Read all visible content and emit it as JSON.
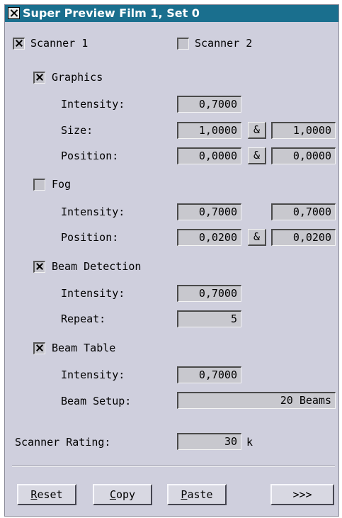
{
  "window": {
    "title": "Super Preview Film 1, Set 0"
  },
  "scanners": [
    {
      "label": "Scanner 1",
      "checked": true
    },
    {
      "label": "Scanner 2",
      "checked": false
    }
  ],
  "graphics": {
    "label": "Graphics",
    "checked": true,
    "intensity_label": "Intensity:",
    "intensity": "0,7000",
    "size_label": "Size:",
    "size_x": "1,0000",
    "size_y": "1,0000",
    "position_label": "Position:",
    "position_x": "0,0000",
    "position_y": "0,0000",
    "link": "&"
  },
  "fog": {
    "label": "Fog",
    "checked": false,
    "intensity_label": "Intensity:",
    "intensity_a": "0,7000",
    "intensity_b": "0,7000",
    "position_label": "Position:",
    "position_x": "0,0200",
    "position_y": "0,0200",
    "link": "&"
  },
  "beam_detection": {
    "label": "Beam Detection",
    "checked": true,
    "intensity_label": "Intensity:",
    "intensity": "0,7000",
    "repeat_label": "Repeat:",
    "repeat": "5"
  },
  "beam_table": {
    "label": "Beam Table",
    "checked": true,
    "intensity_label": "Intensity:",
    "intensity": "0,7000",
    "setup_label": "Beam Setup:",
    "setup": "20 Beams"
  },
  "rating": {
    "label": "Scanner Rating:",
    "value": "30",
    "unit": "k"
  },
  "buttons": {
    "reset": {
      "mnemonic": "R",
      "rest": "eset"
    },
    "copy": {
      "mnemonic": "C",
      "rest": "opy"
    },
    "paste": {
      "mnemonic": "P",
      "rest": "aste"
    },
    "more": ">>>"
  }
}
